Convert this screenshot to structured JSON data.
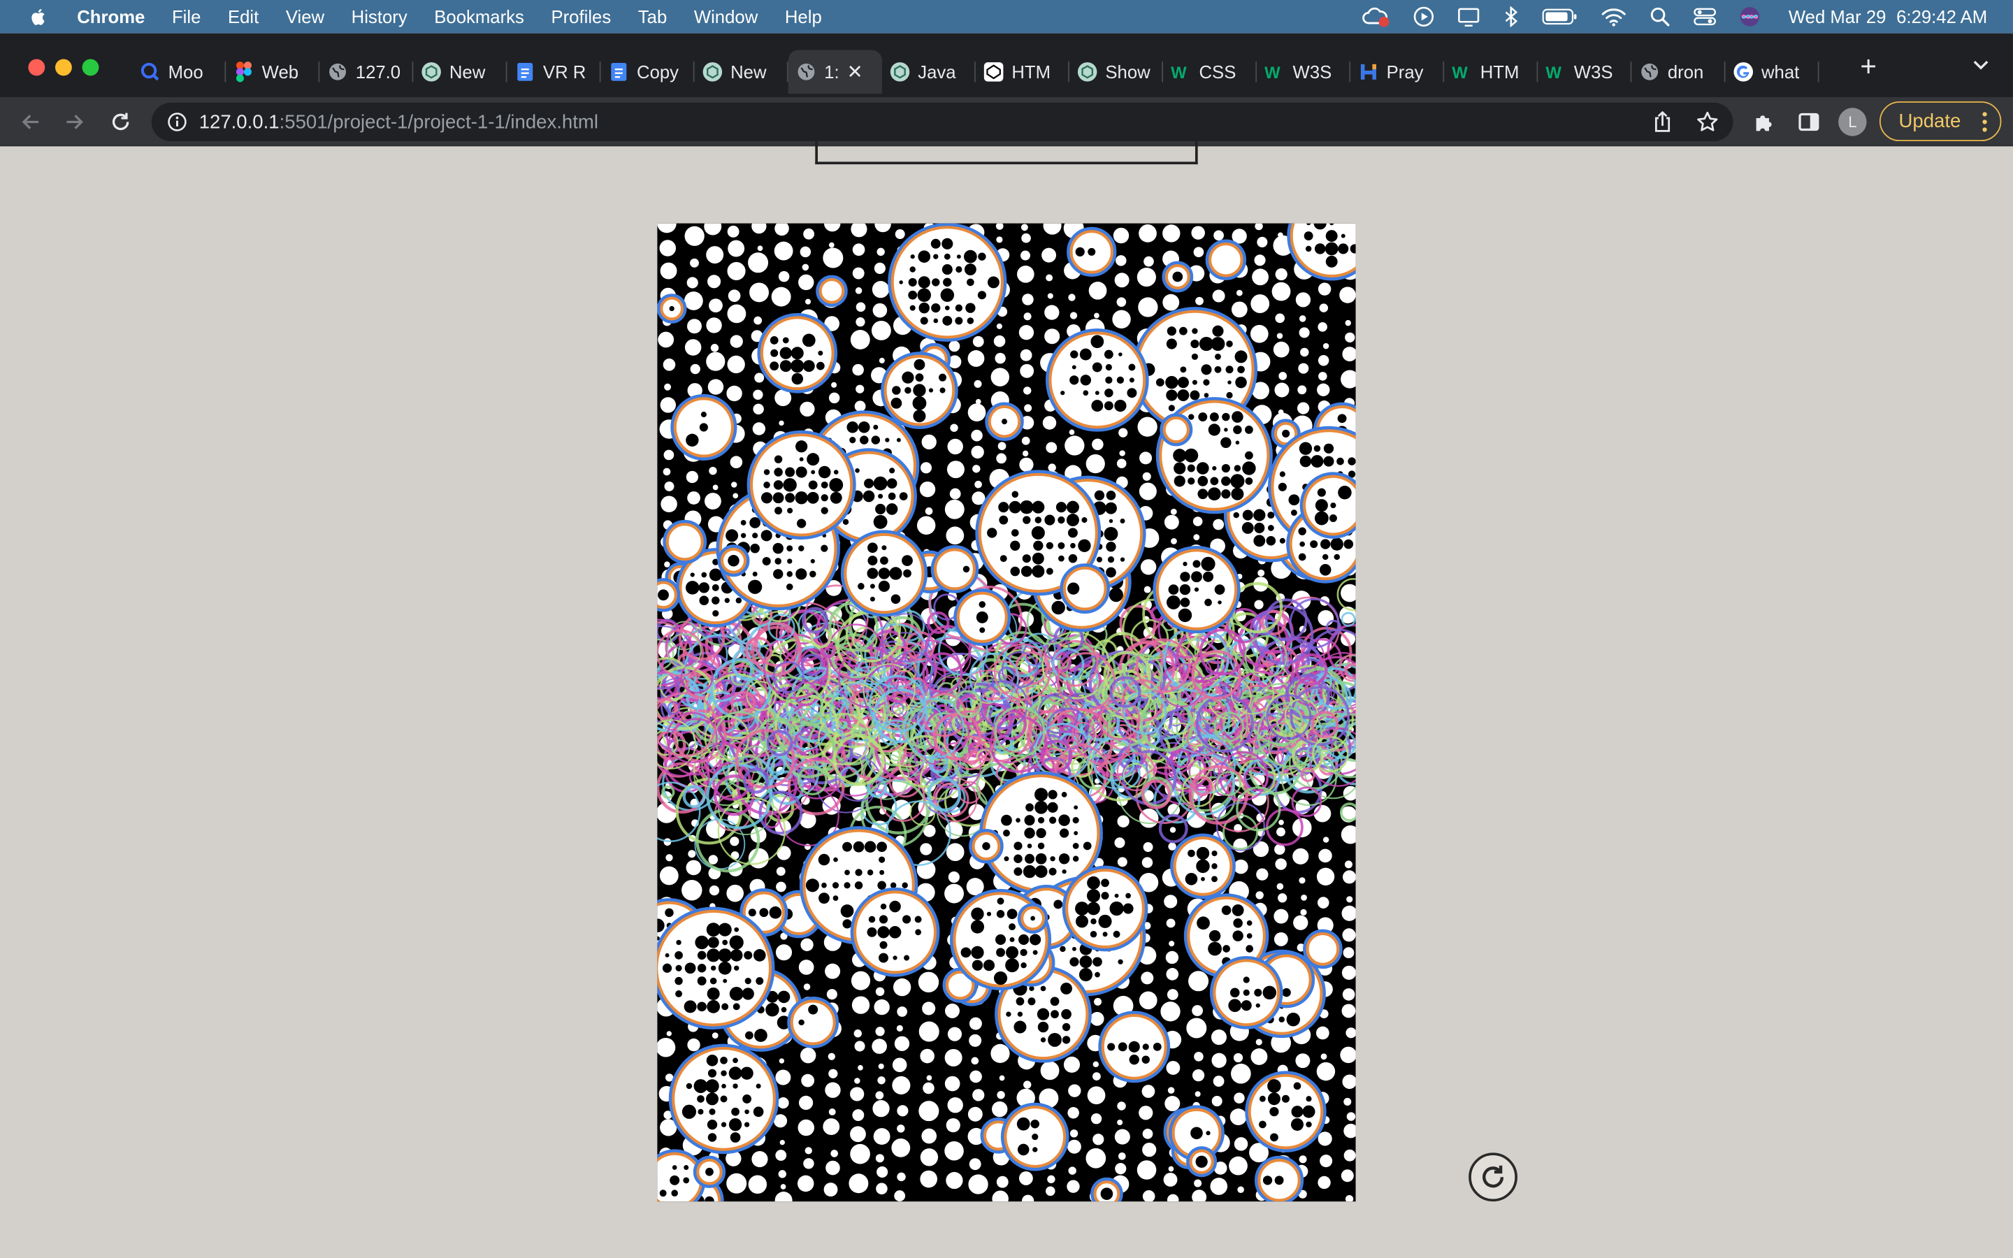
{
  "menubar": {
    "app_name": "Chrome",
    "items": [
      "File",
      "Edit",
      "View",
      "History",
      "Bookmarks",
      "Profiles",
      "Tab",
      "Window",
      "Help"
    ],
    "date": "Wed Mar 29",
    "time": "6:29:42 AM"
  },
  "tabs": [
    {
      "label": "Moo",
      "icon": "search-icon",
      "color": "#3b6cf6"
    },
    {
      "label": "Web",
      "icon": "figma-icon",
      "color": "#f24e1e"
    },
    {
      "label": "127.0",
      "icon": "globe-icon",
      "color": "#9aa0a6"
    },
    {
      "label": "New",
      "icon": "chatgpt-icon",
      "color": "#10a37f"
    },
    {
      "label": "VR R",
      "icon": "docs-icon",
      "color": "#4285f4"
    },
    {
      "label": "Copy",
      "icon": "docs-icon",
      "color": "#4285f4"
    },
    {
      "label": "New",
      "icon": "chatgpt-icon",
      "color": "#10a37f"
    },
    {
      "label": "1:",
      "icon": "globe-icon",
      "color": "#9aa0a6",
      "active": true
    },
    {
      "label": "Java",
      "icon": "chatgpt-icon",
      "color": "#10a37f"
    },
    {
      "label": "HTM",
      "icon": "codepen-icon",
      "color": "#ffffff"
    },
    {
      "label": "Show",
      "icon": "chatgpt-icon",
      "color": "#10a37f"
    },
    {
      "label": "CSS",
      "icon": "w3schools-icon",
      "color": "#04aa6d"
    },
    {
      "label": "W3S",
      "icon": "w3schools-icon",
      "color": "#04aa6d"
    },
    {
      "label": "Pray",
      "icon": "glitch-icon",
      "color": "#3b78e7"
    },
    {
      "label": "HTM",
      "icon": "w3schools-icon",
      "color": "#04aa6d"
    },
    {
      "label": "W3S",
      "icon": "w3schools-icon",
      "color": "#04aa6d"
    },
    {
      "label": "dron",
      "icon": "globe-icon",
      "color": "#9aa0a6"
    },
    {
      "label": "what",
      "icon": "google-icon",
      "color": "#4285f4"
    }
  ],
  "toolbar": {
    "url_host": "127.0.0.1",
    "url_path": ":5501/project-1/project-1-1/index.html",
    "avatar_letter": "L",
    "update_label": "Update"
  },
  "colors": {
    "page_bg": "#d3d0cb",
    "menubar_bg": "#3f6f96",
    "tabstrip_bg": "#1f2023",
    "toolbar_bg": "#35363a",
    "art_bg": "#000000",
    "ring_blue": "#3d7be0",
    "ring_orange": "#e88a3a",
    "band_green": "#8fd18a",
    "band_magenta": "#c845b9"
  }
}
